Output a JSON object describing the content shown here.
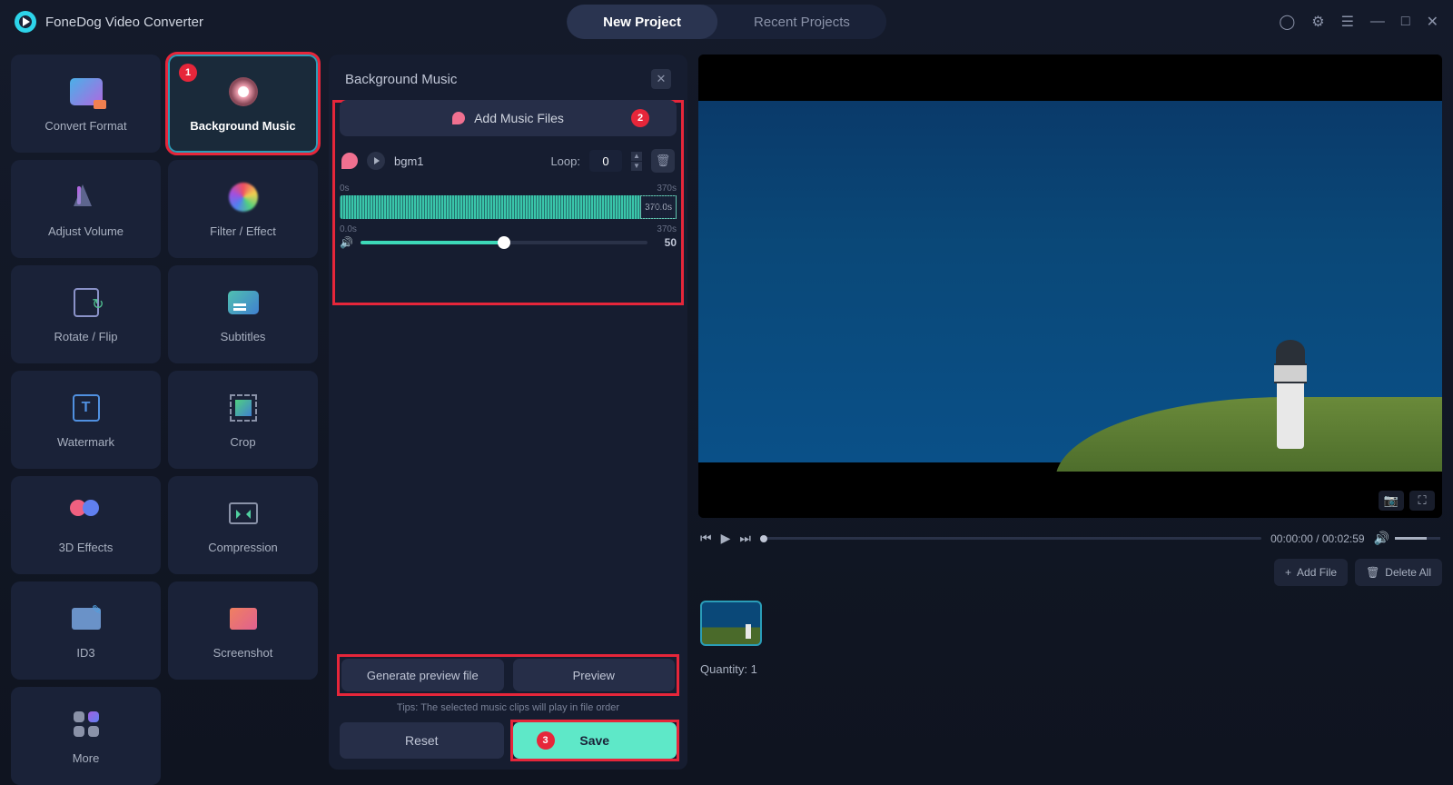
{
  "app_title": "FoneDog Video Converter",
  "tabs": {
    "new_project": "New Project",
    "recent_projects": "Recent Projects"
  },
  "sidebar": {
    "items": [
      {
        "label": "Convert Format"
      },
      {
        "label": "Background Music"
      },
      {
        "label": "Adjust Volume"
      },
      {
        "label": "Filter / Effect"
      },
      {
        "label": "Rotate / Flip"
      },
      {
        "label": "Subtitles"
      },
      {
        "label": "Watermark"
      },
      {
        "label": "Crop"
      },
      {
        "label": "3D Effects"
      },
      {
        "label": "Compression"
      },
      {
        "label": "ID3"
      },
      {
        "label": "Screenshot"
      },
      {
        "label": "More"
      }
    ]
  },
  "panel": {
    "title": "Background Music",
    "add_music": "Add Music Files",
    "track_name": "bgm1",
    "loop_label": "Loop:",
    "loop_value": "0",
    "wave_start": "0s",
    "wave_end": "370s",
    "wave_handle": "370.0s",
    "vol_start": "0.0s",
    "vol_end": "370s",
    "volume_value": "50",
    "volume_percent": 50,
    "generate": "Generate preview file",
    "preview": "Preview",
    "tips": "Tips: The selected music clips will play in file order",
    "reset": "Reset",
    "save": "Save"
  },
  "player": {
    "time": "00:00:00 / 00:02:59"
  },
  "actions": {
    "add_file": "Add File",
    "delete_all": "Delete All"
  },
  "footer": {
    "quantity_label": "Quantity:",
    "quantity_value": "1"
  },
  "badges": {
    "b1": "1",
    "b2": "2",
    "b3": "3"
  }
}
